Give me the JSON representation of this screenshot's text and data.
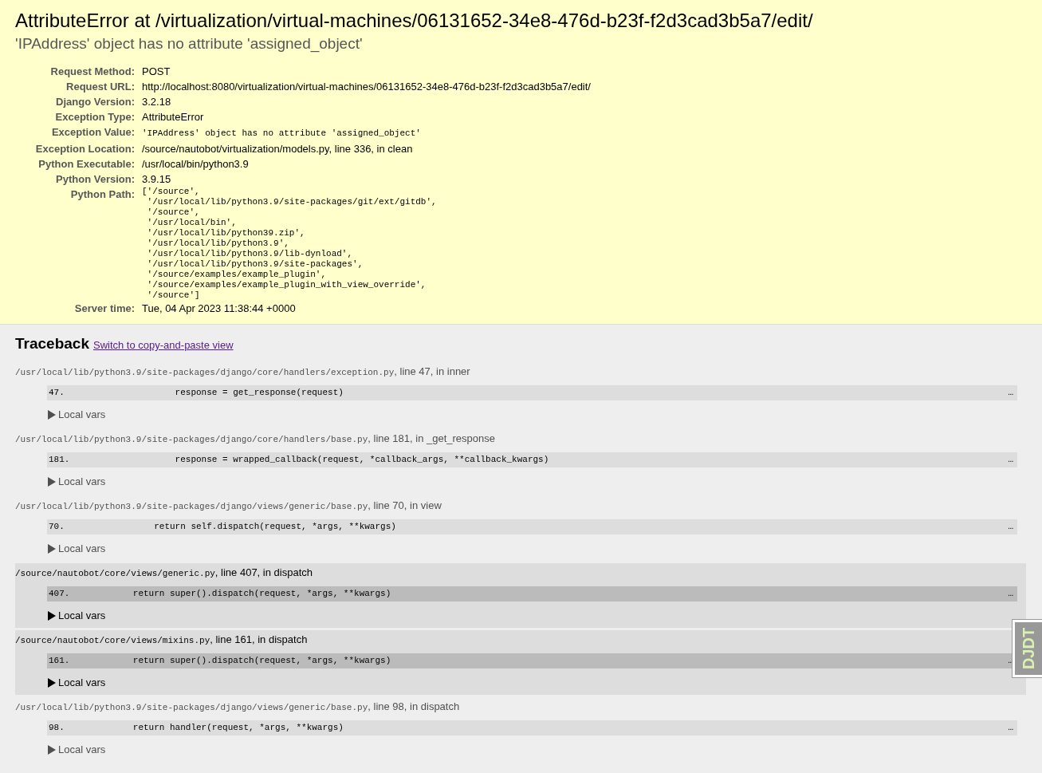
{
  "error": {
    "title": "AttributeError at /virtualization/virtual-machines/06131652-34e8-476d-b23f-f2d3cad3b5a7/edit/",
    "message": "'IPAddress' object has no attribute 'assigned_object'"
  },
  "meta": [
    {
      "label": "Request Method:",
      "value": "POST",
      "kind": "text"
    },
    {
      "label": "Request URL:",
      "value": "http://localhost:8080/virtualization/virtual-machines/06131652-34e8-476d-b23f-f2d3cad3b5a7/edit/",
      "kind": "text"
    },
    {
      "label": "Django Version:",
      "value": "3.2.18",
      "kind": "text"
    },
    {
      "label": "Exception Type:",
      "value": "AttributeError",
      "kind": "text"
    },
    {
      "label": "Exception Value:",
      "value": "'IPAddress' object has no attribute 'assigned_object'",
      "kind": "code"
    },
    {
      "label": "Exception Location:",
      "value": "/source/nautobot/virtualization/models.py, line 336, in clean",
      "kind": "text"
    },
    {
      "label": "Python Executable:",
      "value": "/usr/local/bin/python3.9",
      "kind": "text"
    },
    {
      "label": "Python Version:",
      "value": "3.9.15",
      "kind": "text"
    },
    {
      "label": "Python Path:",
      "kind": "list",
      "lines": [
        "['/source',",
        " '/usr/local/lib/python3.9/site-packages/git/ext/gitdb',",
        " '/source',",
        " '/usr/local/bin',",
        " '/usr/local/lib/python39.zip',",
        " '/usr/local/lib/python3.9',",
        " '/usr/local/lib/python3.9/lib-dynload',",
        " '/usr/local/lib/python3.9/site-packages',",
        " '/source/examples/example_plugin',",
        " '/source/examples/example_plugin_with_view_override',",
        " '/source']"
      ]
    },
    {
      "label": "Server time:",
      "value": "Tue, 04 Apr 2023 11:38:44 +0000",
      "kind": "text"
    }
  ],
  "traceback": {
    "title": "Traceback",
    "switch_link": "Switch to copy-and-paste view",
    "frames": [
      {
        "kind": "django",
        "file": "/usr/local/lib/python3.9/site-packages/django/core/handlers/exception.py",
        "where": ", line 47, in inner",
        "lineno": "47.",
        "code": "                response = get_response(request)",
        "more": "…",
        "vars": "Local vars"
      },
      {
        "kind": "django",
        "file": "/usr/local/lib/python3.9/site-packages/django/core/handlers/base.py",
        "where": ", line 181, in _get_response",
        "lineno": "181.",
        "code": "                response = wrapped_callback(request, *callback_args, **callback_kwargs)",
        "more": "…",
        "vars": "Local vars"
      },
      {
        "kind": "django",
        "file": "/usr/local/lib/python3.9/site-packages/django/views/generic/base.py",
        "where": ", line 70, in view",
        "lineno": "70.",
        "code": "            return self.dispatch(request, *args, **kwargs)",
        "more": "…",
        "vars": "Local vars"
      },
      {
        "kind": "user",
        "file": "/source/nautobot/core/views/generic.py",
        "where": ", line 407, in dispatch",
        "lineno": "407.",
        "code": "        return super().dispatch(request, *args, **kwargs)",
        "more": "…",
        "vars": "Local vars"
      },
      {
        "kind": "user",
        "file": "/source/nautobot/core/views/mixins.py",
        "where": ", line 161, in dispatch",
        "lineno": "161.",
        "code": "        return super().dispatch(request, *args, **kwargs)",
        "more": "…",
        "vars": "Local vars"
      },
      {
        "kind": "django",
        "file": "/usr/local/lib/python3.9/site-packages/django/views/generic/base.py",
        "where": ", line 98, in dispatch",
        "lineno": "98.",
        "code": "        return handler(request, *args, **kwargs)",
        "more": "…",
        "vars": "Local vars"
      }
    ]
  },
  "toolbar_handle": {
    "label": "DJDT"
  }
}
